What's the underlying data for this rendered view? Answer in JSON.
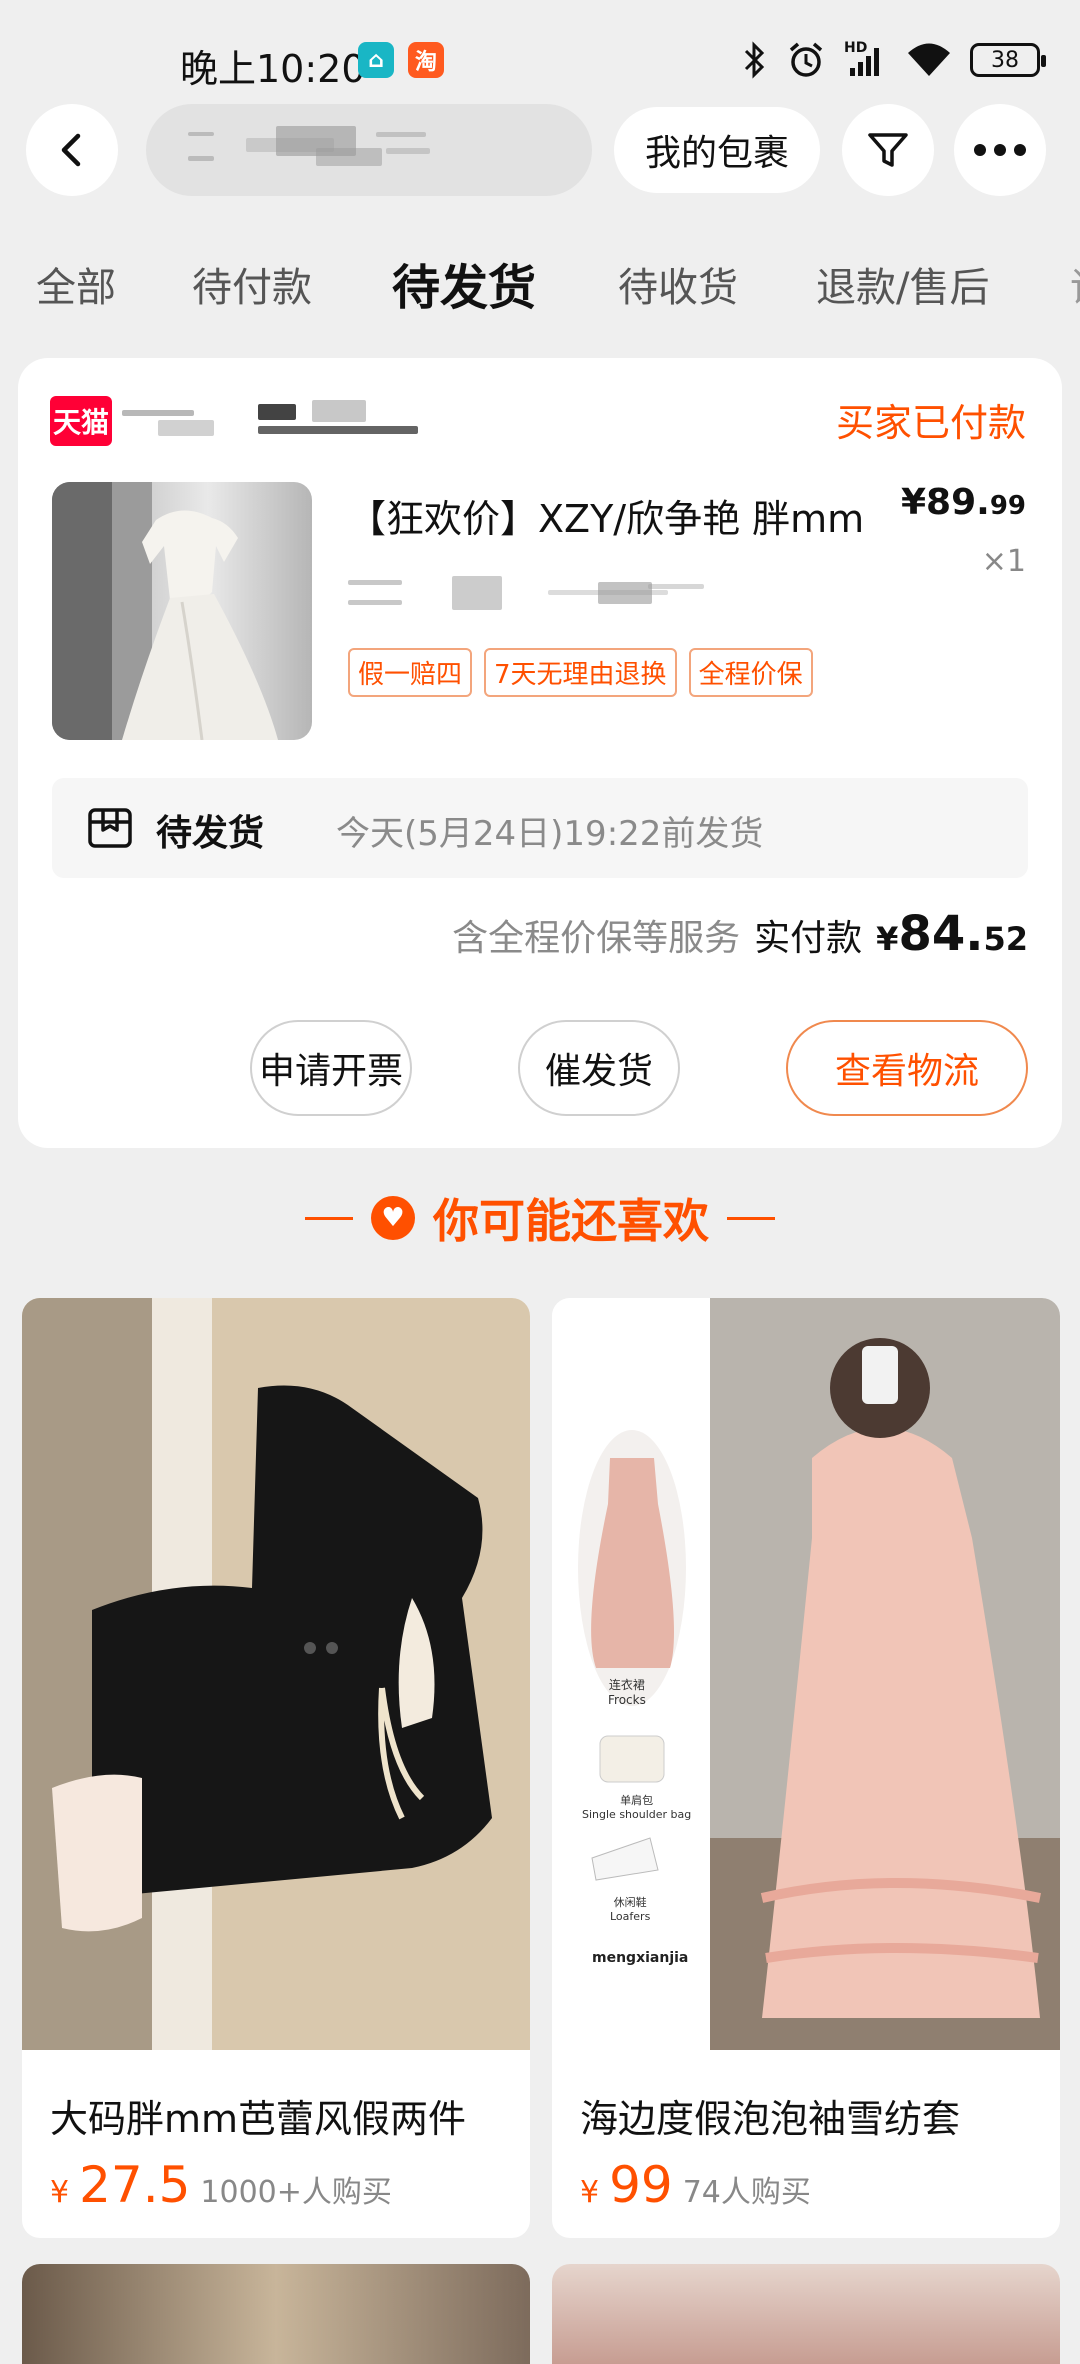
{
  "status_bar": {
    "time": "晚上10:20",
    "app_icon_1": "home-app-icon",
    "app_icon_2": "taobao-app-icon",
    "app_icon_2_text": "淘",
    "battery": "38",
    "network": "HD"
  },
  "header": {
    "back_icon": "chevron-left-icon",
    "my_packages": "我的包裹",
    "filter_icon": "filter-icon",
    "more_icon": "more-icon"
  },
  "tabs": [
    {
      "label": "全部"
    },
    {
      "label": "待付款"
    },
    {
      "label": "待发货"
    },
    {
      "label": "待收货"
    },
    {
      "label": "退款/售后"
    }
  ],
  "active_tab": "待发货",
  "order": {
    "platform_badge": "天猫",
    "status": "买家已付款",
    "product_title": "【狂欢价】XZY/欣争艳 胖mm",
    "price_int": "¥89.",
    "price_dec": "99",
    "quantity": "×1",
    "service_tags": [
      "假一赔四",
      "7天无理由退换",
      "全程价保"
    ],
    "ship_label": "待发货",
    "ship_time": "今天(5月24日)19:22前发货",
    "pay_note": "含全程价保等服务",
    "pay_label": "实付款",
    "pay_currency": "¥",
    "pay_int": "84.",
    "pay_dec": "52",
    "buttons": {
      "invoice": "申请开票",
      "urge": "催发货",
      "logistics": "查看物流"
    }
  },
  "recommend": {
    "title": "你可能还喜欢",
    "items": [
      {
        "name": "大码胖mm芭蕾风假两件",
        "currency": "¥",
        "price": "27.5",
        "sales": "1000+人购买"
      },
      {
        "name": "海边度假泡泡袖雪纺套",
        "currency": "¥",
        "price": "99",
        "sales": "74人购买"
      }
    ],
    "item2_image_text": {
      "frocks": "连衣裙\nFrocks",
      "bag": "单肩包\nSingle shoulder bag",
      "loafers": "休闲鞋\nLoafers",
      "brand": "mengxianjia"
    }
  }
}
